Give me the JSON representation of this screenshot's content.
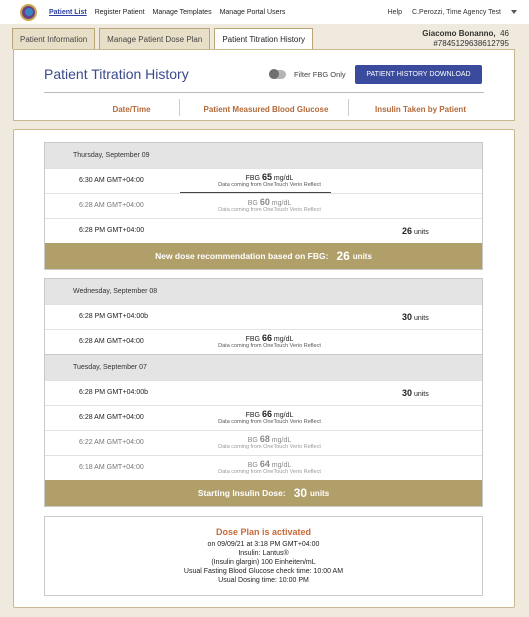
{
  "nav": {
    "items": [
      "Patient List",
      "Register Patient",
      "Manage Templates",
      "Manage Portal Users"
    ],
    "help": "Help",
    "user": "C.Perozzi, Time Agency Test"
  },
  "tabs": [
    "Patient Information",
    "Manage Patient Dose Plan",
    "Patient Titration History"
  ],
  "patient": {
    "name": "Giacomo Bonanno,",
    "age": "46",
    "id": "#7845129638612795"
  },
  "header": {
    "title": "Patient Titration History",
    "filter_label": "Filter FBG Only",
    "download_label": "PATIENT HISTORY DOWNLOAD",
    "columns": [
      "Date/Time",
      "Patient Measured Blood Glucose",
      "Insulin Taken by Patient"
    ]
  },
  "groups": [
    {
      "date": "Thursday, September 09",
      "rows": [
        {
          "time": "6:30 AM GMT+04:00",
          "type": "FBG",
          "value": "65",
          "unit": "mg/dL",
          "source": "Data coming from OneTouch Verio Reflect",
          "muted": false
        },
        {
          "time": "6:28 AM GMT+04:00",
          "type": "BG",
          "value": "60",
          "unit": "mg/dL",
          "source": "Data coming from OneTouch Verio Reflect",
          "muted": true
        },
        {
          "time": "6:28 PM GMT+04:00",
          "units_value": "26",
          "units_label": "units"
        }
      ],
      "bar": {
        "label": "New dose recommendation based on FBG:",
        "value": "26",
        "unit": "units"
      }
    },
    {
      "date": "Wednesday, September 08",
      "rows": [
        {
          "time": "6:28 PM GMT+04:00b",
          "units_value": "30",
          "units_label": "units"
        },
        {
          "time": "6:28 AM GMT+04:00",
          "type": "FBG",
          "value": "66",
          "unit": "mg/dL",
          "source": "Data coming from OneTouch Verio Reflect",
          "muted": false
        }
      ]
    },
    {
      "date": "Tuesday, September 07",
      "rows": [
        {
          "time": "6:28 PM GMT+04:00b",
          "units_value": "30",
          "units_label": "units"
        },
        {
          "time": "6:28 AM GMT+04:00",
          "type": "FBG",
          "value": "66",
          "unit": "mg/dL",
          "source": "Data coming from OneTouch Verio Reflect",
          "muted": false
        },
        {
          "time": "6:22 AM GMT+04:00",
          "type": "BG",
          "value": "68",
          "unit": "mg/dL",
          "source": "Data coming from OneTouch Verio Reflect",
          "muted": true
        },
        {
          "time": "6:18 AM GMT+04:00",
          "type": "BG",
          "value": "64",
          "unit": "mg/dL",
          "source": "Data coming from OneTouch Verio Reflect",
          "muted": true
        }
      ],
      "bar": {
        "label": "Starting Insulin Dose:",
        "value": "30",
        "unit": "units"
      }
    }
  ],
  "plan": {
    "title": "Dose Plan is activated",
    "lines": [
      "on 09/09/21 at 3:18 PM GMT+04:00",
      "Insulin: Lantus®",
      "(Insulin glargin) 100 Einheiten/mL",
      "Usual Fasting Blood Glucose check time: 10:00 AM",
      "Usual Dosing time: 10:00 PM"
    ]
  },
  "colors": {
    "accent_gold": "#b19f6a",
    "title_blue": "#3a4a8c",
    "button_blue": "#3a4a9c",
    "header_orange": "#b36a3a"
  }
}
